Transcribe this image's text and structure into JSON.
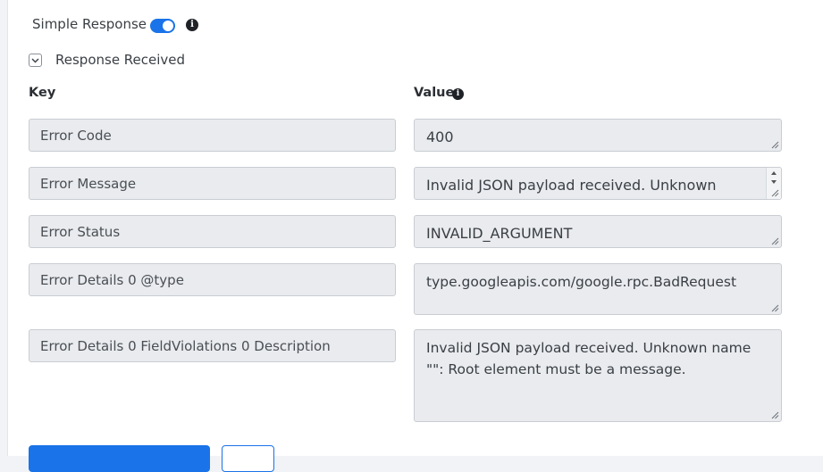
{
  "response": {
    "simple_response_label": "Simple Response",
    "simple_response_enabled": true,
    "received_label": "Response Received"
  },
  "columns": {
    "key": "Key",
    "value": "Value"
  },
  "rows": [
    {
      "key": "Error Code",
      "value": "400"
    },
    {
      "key": "Error Message",
      "value": "Invalid JSON payload received. Unknown name \"\": Root element must be a message."
    },
    {
      "key": "Error Status",
      "value": "INVALID_ARGUMENT"
    },
    {
      "key": "Error Details 0 @type",
      "value": "type.googleapis.com/google.rpc.BadRequest"
    },
    {
      "key": "Error Details 0 FieldViolations 0 Description",
      "value": "Invalid JSON payload received. Unknown name \"\": Root element must be a message."
    }
  ],
  "icons": {
    "info": "info-icon",
    "chevron": "chevron-down-icon",
    "resize": "resize-handle-icon"
  },
  "colors": {
    "accent": "#1a73e8",
    "field_bg": "#e9ebee"
  }
}
